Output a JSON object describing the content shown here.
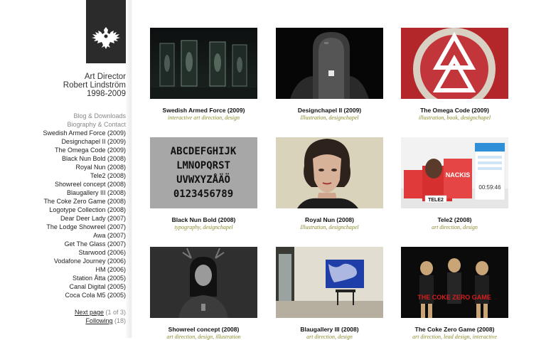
{
  "identity": {
    "role": "Art Director",
    "name": "Robert Lindström",
    "years": "1998-2009"
  },
  "nav": {
    "secondary": [
      "Blog & Downloads",
      "Biography & Contact"
    ],
    "projects": [
      "Swedish Armed Force (2009)",
      "Designchapel II (2009)",
      "The Omega Code (2009)",
      "Black Nun Bold (2008)",
      "Royal Nun (2008)",
      "Tele2 (2008)",
      "Showreel concept (2008)",
      "Blaugallery III (2008)",
      "The Coke Zero Game (2008)",
      "Logotype Collection (2008)",
      "Dear Deer Lady (2007)",
      "The Lodge Showreel (2007)",
      "Awa (2007)",
      "Get The Glass (2007)",
      "Starwood (2006)",
      "Vodafone Journey (2006)",
      "HM (2006)",
      "Station Åtta (2005)",
      "Canal Digital (2005)",
      "Coca Cola M5 (2005)"
    ]
  },
  "pager": {
    "next_label": "Next page",
    "next_count": "(1 of 3)",
    "following_label": "Following",
    "following_count": "(18)"
  },
  "cards": [
    {
      "title": "Swedish Armed Force (2009)",
      "tags": "interactive art direction, design"
    },
    {
      "title": "Designchapel II (2009)",
      "tags": "Illustration, designchapel"
    },
    {
      "title": "The Omega Code (2009)",
      "tags": "illustration, book, designchapel"
    },
    {
      "title": "Black Nun Bold (2008)",
      "tags": "typography, designchapel"
    },
    {
      "title": "Royal Nun (2008)",
      "tags": "Illustration, designchapel"
    },
    {
      "title": "Tele2 (2008)",
      "tags": "art direction, design"
    },
    {
      "title": "Showreel concept (2008)",
      "tags": "art direction, design, illustration"
    },
    {
      "title": "Blaugallery III (2008)",
      "tags": "art direction, design"
    },
    {
      "title": "The Coke Zero Game (2008)",
      "tags": "art direction, lead design, interactive"
    }
  ],
  "thumb_text": {
    "font_rows": [
      "ABCDEFGHIJK",
      "LMNOPQRST",
      "UVWXYZÅÄÖ",
      "0123456789"
    ],
    "tele2_brand": "NACKIS",
    "tele2_logo": "TELE2",
    "tele2_timer": "00:59:46",
    "coke_title": "THE COKE ZERO GAME"
  },
  "colors": {
    "accent_tags": "#8a8a2e",
    "logo_bg": "#2b2b2b"
  }
}
